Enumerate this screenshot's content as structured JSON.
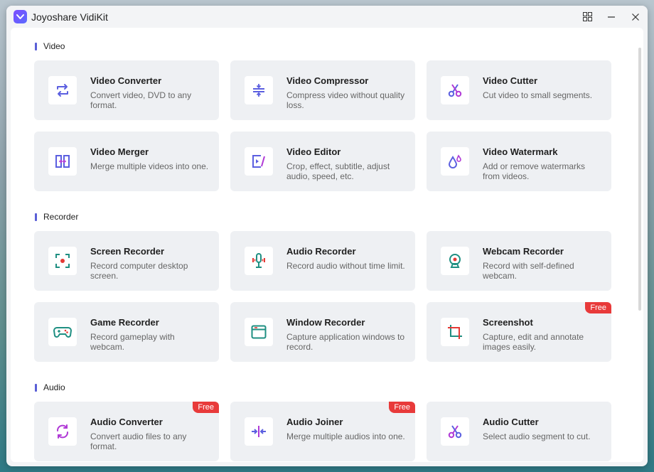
{
  "window": {
    "title": "Joyoshare VidiKit"
  },
  "sections": [
    {
      "title": "Video",
      "cards": [
        {
          "title": "Video Converter",
          "desc": "Convert video, DVD to any format.",
          "icon": "convert-icon"
        },
        {
          "title": "Video Compressor",
          "desc": "Compress video without quality loss.",
          "icon": "compress-icon"
        },
        {
          "title": "Video Cutter",
          "desc": "Cut video to small segments.",
          "icon": "scissors-icon"
        },
        {
          "title": "Video Merger",
          "desc": "Merge multiple videos into one.",
          "icon": "merge-icon"
        },
        {
          "title": "Video Editor",
          "desc": "Crop, effect, subtitle, adjust audio, speed, etc.",
          "icon": "edit-icon"
        },
        {
          "title": "Video Watermark",
          "desc": "Add or remove watermarks from videos.",
          "icon": "watermark-icon"
        }
      ]
    },
    {
      "title": "Recorder",
      "cards": [
        {
          "title": "Screen Recorder",
          "desc": "Record computer desktop screen.",
          "icon": "screen-record-icon"
        },
        {
          "title": "Audio Recorder",
          "desc": "Record audio without time limit.",
          "icon": "microphone-icon"
        },
        {
          "title": "Webcam Recorder",
          "desc": "Record with self-defined webcam.",
          "icon": "webcam-icon"
        },
        {
          "title": "Game Recorder",
          "desc": "Record gameplay with webcam.",
          "icon": "gamepad-icon"
        },
        {
          "title": "Window Recorder",
          "desc": "Capture application windows to record.",
          "icon": "window-icon"
        },
        {
          "title": "Screenshot",
          "desc": "Capture, edit and annotate images easily.",
          "icon": "crop-icon",
          "badge": "Free"
        }
      ]
    },
    {
      "title": "Audio",
      "cards": [
        {
          "title": "Audio Converter",
          "desc": "Convert audio files to any format.",
          "icon": "audio-convert-icon",
          "badge": "Free"
        },
        {
          "title": "Audio Joiner",
          "desc": "Merge multiple audios into one.",
          "icon": "audio-join-icon",
          "badge": "Free"
        },
        {
          "title": "Audio Cutter",
          "desc": "Select audio segment to cut.",
          "icon": "audio-cut-icon"
        }
      ]
    }
  ],
  "colors": {
    "section_accent": "#5a5fd6",
    "card_bg": "#eef0f3",
    "badge": "#e83a3a",
    "video_icon": "#5b5fe0",
    "recorder_icon": "#1f8f82",
    "recorder_dot": "#e53935",
    "audio_icon": "#b03ad6"
  }
}
